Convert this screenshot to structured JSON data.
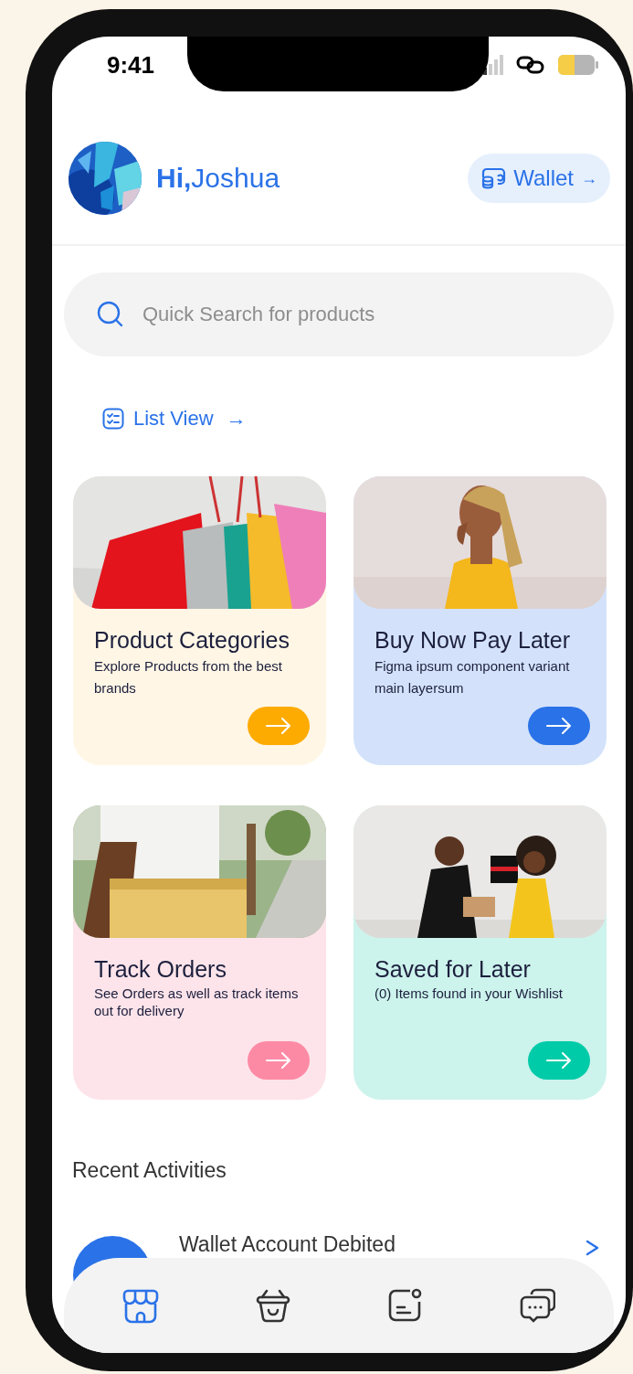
{
  "status_bar": {
    "time": "9:41"
  },
  "header": {
    "greeting": "**Hi,**Joshua",
    "wallet_button": "Wallet",
    "wallet_arrow": "→"
  },
  "search": {
    "placeholder": "Quick Search for products"
  },
  "list_view": {
    "label": "List View",
    "arrow": "→"
  },
  "cards": [
    {
      "title": "Product Categories",
      "description": "Explore Products from the best brands",
      "color": "#fff6e5"
    },
    {
      "title": "Buy Now Pay Later",
      "description": "Figma ipsum component variant main layersum",
      "color": "#d3e2fa"
    },
    {
      "title": "Track Orders",
      "description": "See Orders as well as track items out for delivery",
      "color": "#fde4ea"
    },
    {
      "title": "Saved for Later",
      "description": "(0) Items found in your Wishlist",
      "color": "#ccf3ec"
    }
  ],
  "recent": {
    "title": "Recent Activities",
    "items": [
      {
        "title": "Wallet Account Debited"
      }
    ]
  },
  "nav": [
    {
      "selected": true
    },
    {
      "selected": false
    },
    {
      "selected": false
    },
    {
      "selected": false
    }
  ]
}
